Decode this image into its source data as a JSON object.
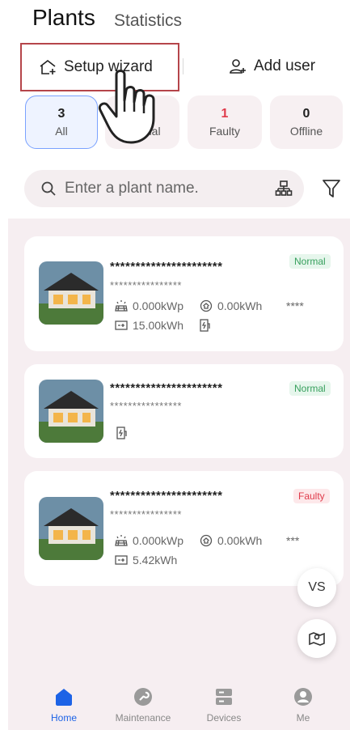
{
  "header": {
    "title": "Plants",
    "subtitle": "Statistics"
  },
  "actions": {
    "wizard_label": "Setup wizard",
    "add_user_label": "Add user"
  },
  "filters": [
    {
      "count": "3",
      "label": "All"
    },
    {
      "count": "",
      "label": "Normal"
    },
    {
      "count": "1",
      "label": "Faulty"
    },
    {
      "count": "0",
      "label": "Offline"
    }
  ],
  "search": {
    "placeholder": "Enter a plant name."
  },
  "plants": [
    {
      "name": "**********************",
      "id": "****************",
      "status": "Normal",
      "capacity": "0.000kWp",
      "energy": "0.00kWh",
      "extra": "****",
      "storage": "15.00kWh"
    },
    {
      "name": "**********************",
      "id": "****************",
      "status": "Normal"
    },
    {
      "name": "**********************",
      "id": "****************",
      "status": "Faulty",
      "capacity": "0.000kWp",
      "energy": "0.00kWh",
      "extra": "***",
      "storage": "5.42kWh"
    }
  ],
  "fab": {
    "vs_label": "VS"
  },
  "nav": [
    {
      "label": "Home"
    },
    {
      "label": "Maintenance"
    },
    {
      "label": "Devices"
    },
    {
      "label": "Me"
    }
  ],
  "colors": {
    "accent": "#1d63e6",
    "faulty": "#e03b4b",
    "normal": "#37a05d"
  }
}
